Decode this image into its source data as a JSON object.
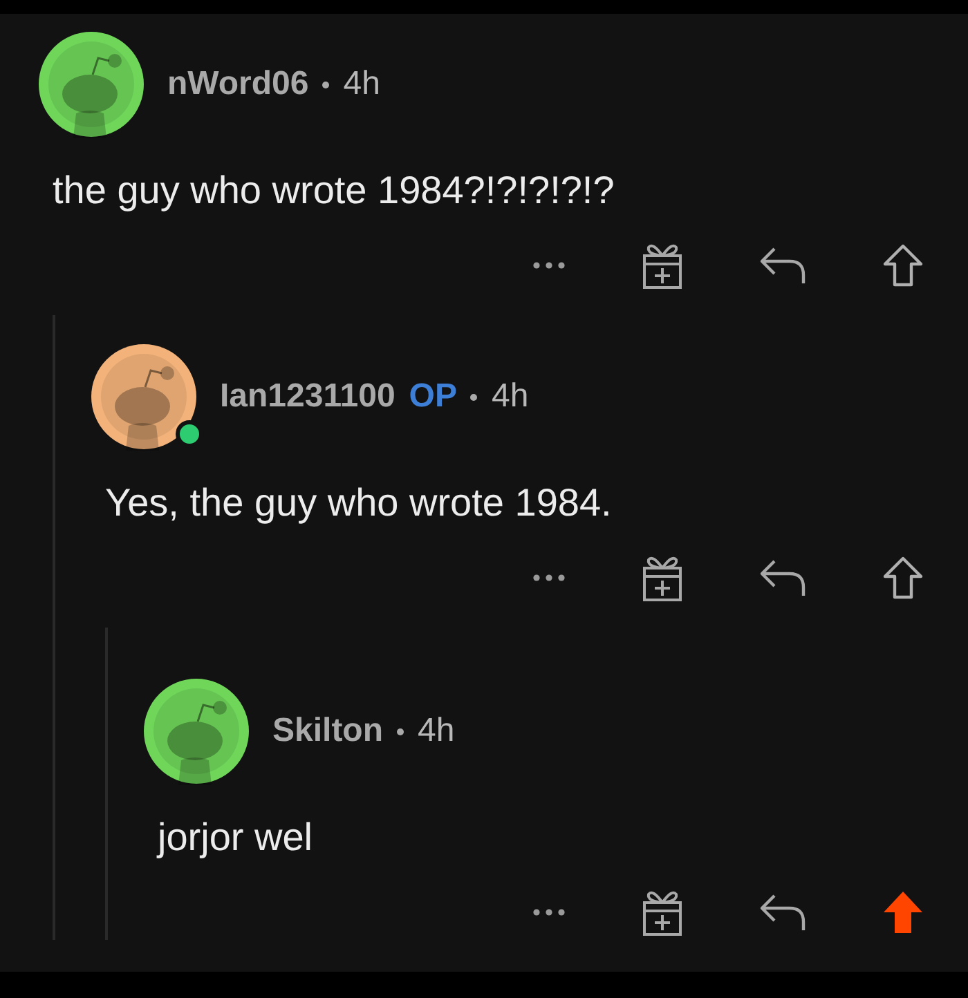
{
  "comments": [
    {
      "username": "nWord06",
      "time": "4h",
      "op": false,
      "online": false,
      "color": "#6fd65a",
      "body": "the guy who wrote 1984?!?!?!?!?",
      "upvoted": false,
      "children": [
        {
          "username": "Ian1231100",
          "op_label": "OP",
          "time": "4h",
          "op": true,
          "online": true,
          "color": "#f2b27a",
          "body": "Yes, the guy who wrote 1984.",
          "upvoted": false,
          "children": [
            {
              "username": "Skilton",
              "time": "4h",
              "op": false,
              "online": false,
              "color": "#6fd65a",
              "body": "jorjor wel",
              "upvoted": true
            }
          ]
        }
      ]
    }
  ]
}
